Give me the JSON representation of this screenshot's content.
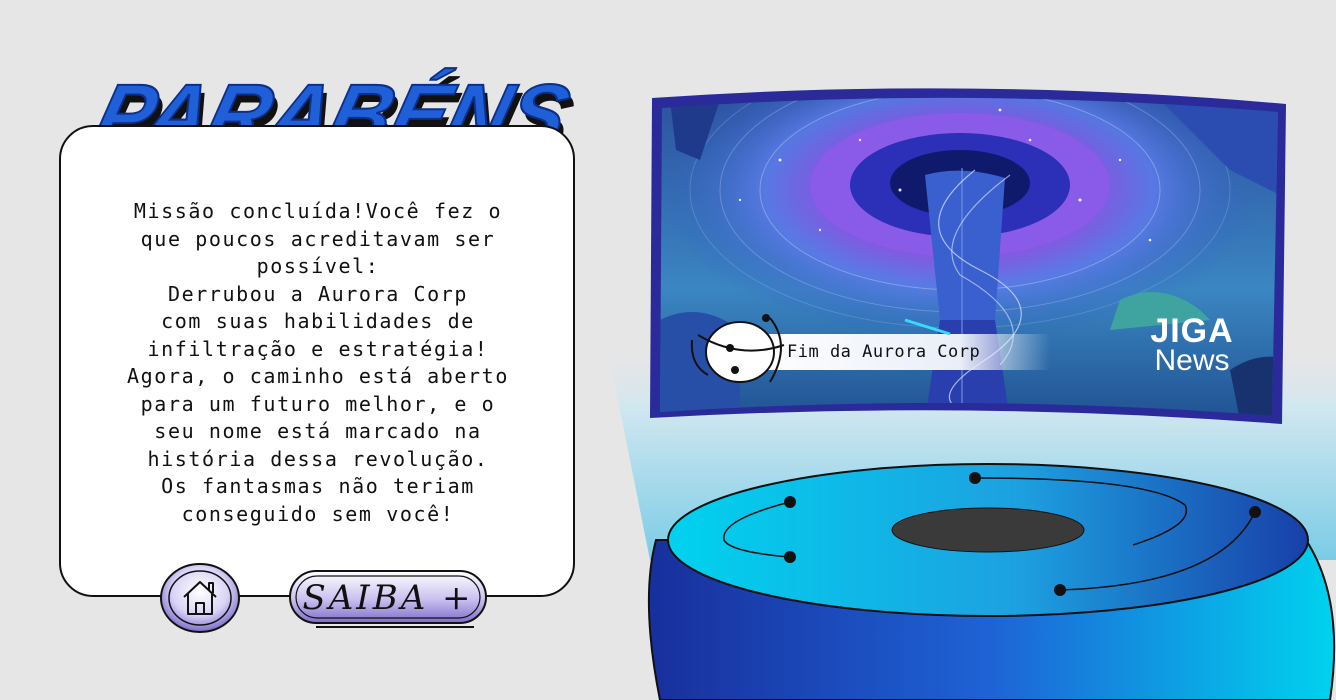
{
  "title": "PARABÉNS",
  "message": "Missão concluída!Você fez o\nque poucos acreditavam ser\npossível:\nDerrubou a Aurora Corp\ncom suas habilidades de\ninfiltração e estratégia!\nAgora, o caminho está aberto\npara um futuro melhor, e o\nseu nome está marcado na\nhistória dessa revolução.\nOs fantasmas não teriam\nconseguido sem você!",
  "buttons": {
    "home_icon": "home-icon",
    "saiba_label": "Saiba +"
  },
  "news": {
    "caption": "Fim da Aurora Corp",
    "brand_line1": "JIGA",
    "brand_line2": "News"
  },
  "colors": {
    "title_blue": "#1f5fd8",
    "accent_cyan": "#00c8e6",
    "deep_blue": "#1b2f9e",
    "button_purple": "#8c7fd6"
  }
}
